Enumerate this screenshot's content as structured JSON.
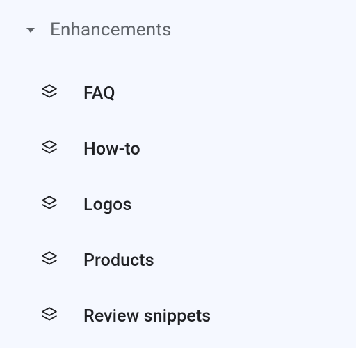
{
  "section": {
    "title": "Enhancements",
    "items": [
      {
        "label": "FAQ"
      },
      {
        "label": "How-to"
      },
      {
        "label": "Logos"
      },
      {
        "label": "Products"
      },
      {
        "label": "Review snippets"
      }
    ]
  }
}
